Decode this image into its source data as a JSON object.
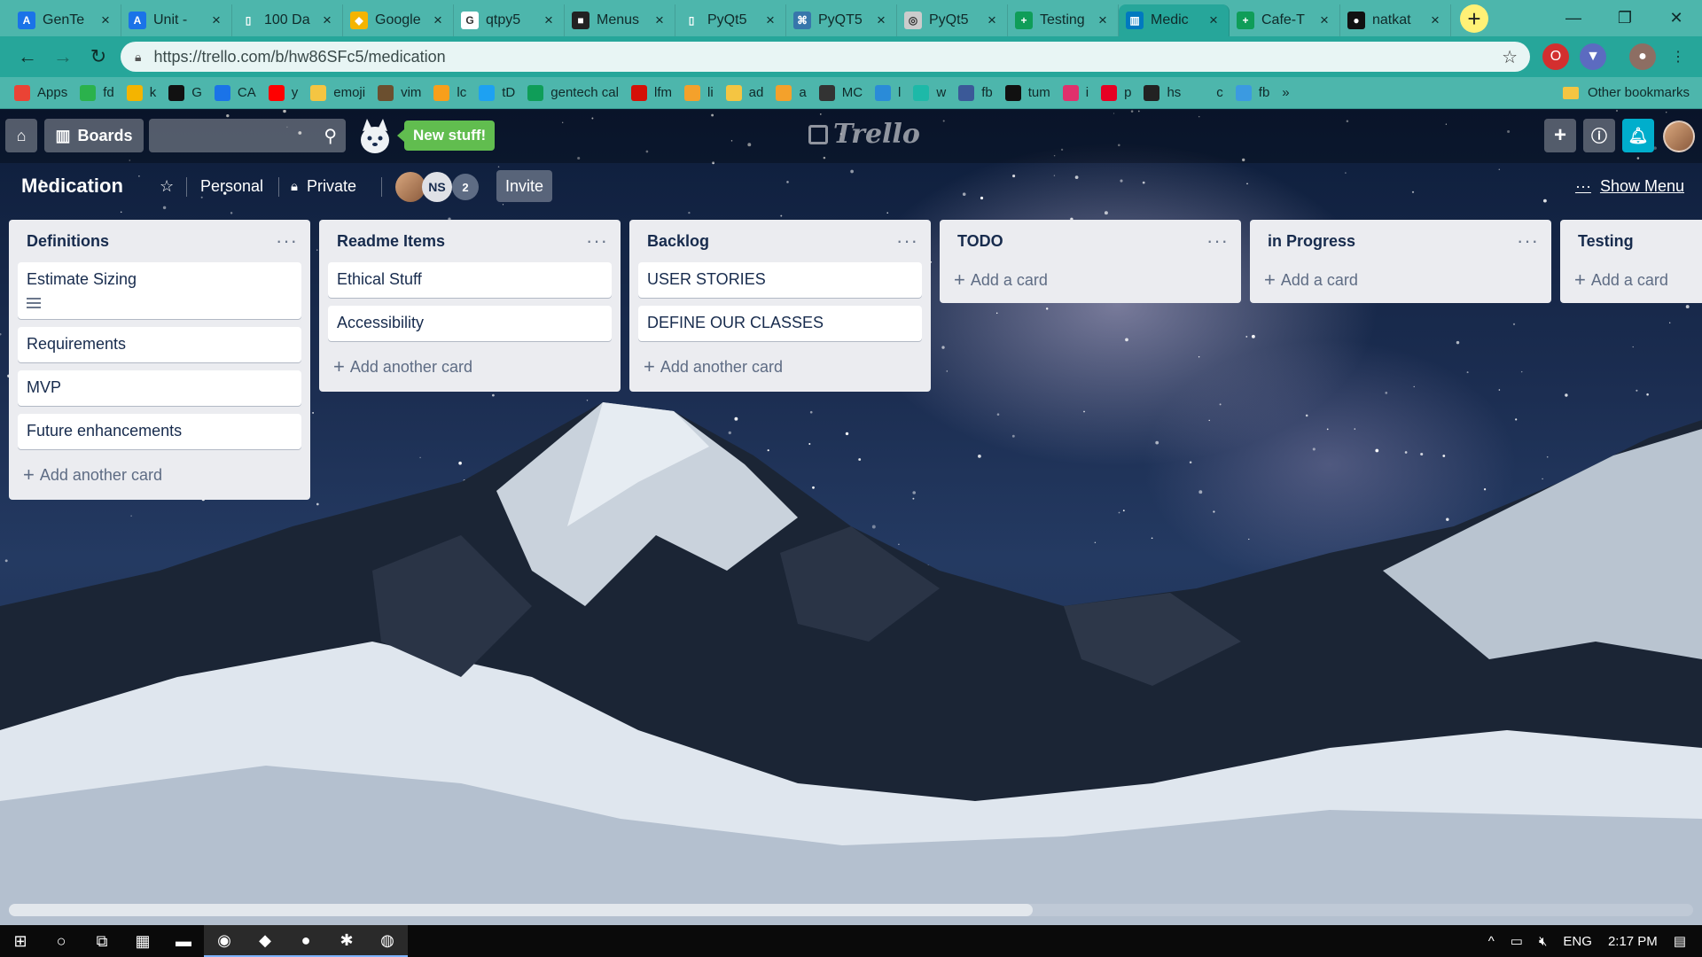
{
  "browser": {
    "tabs": [
      {
        "label": "GenTe",
        "icon": "gentech-icon",
        "color": "#1a73e8",
        "glyph": "A"
      },
      {
        "label": "Unit -",
        "icon": "atlassian-icon",
        "color": "#1a73e8",
        "glyph": "A"
      },
      {
        "label": "100 Da",
        "icon": "document-icon",
        "color": "#4db6ac",
        "glyph": "▯"
      },
      {
        "label": "Google",
        "icon": "keep-icon",
        "color": "#f4b400",
        "glyph": "◆"
      },
      {
        "label": "qtpy5",
        "icon": "google-icon",
        "color": "#ffffff",
        "glyph": "G"
      },
      {
        "label": "Menus",
        "icon": "page-icon",
        "color": "#222222",
        "glyph": "■"
      },
      {
        "label": "PyQt5",
        "icon": "document-icon",
        "color": "#4db6ac",
        "glyph": "▯"
      },
      {
        "label": "PyQT5",
        "icon": "python-icon",
        "color": "#3776ab",
        "glyph": "⌘"
      },
      {
        "label": "PyQt5",
        "icon": "pyqt-icon",
        "color": "#cccccc",
        "glyph": "◎"
      },
      {
        "label": "Testing",
        "icon": "sheets-icon",
        "color": "#0f9d58",
        "glyph": "+"
      },
      {
        "label": "Medic",
        "icon": "trello-icon",
        "color": "#0079bf",
        "glyph": "▥",
        "active": true
      },
      {
        "label": "Cafe-T",
        "icon": "sheets-icon",
        "color": "#0f9d58",
        "glyph": "+"
      },
      {
        "label": "natkat",
        "icon": "github-icon",
        "color": "#111111",
        "glyph": "●"
      }
    ],
    "url": "https://trello.com/b/hw86SFc5/medication",
    "bookmarks": [
      {
        "label": "Apps",
        "icon": "apps-icon",
        "color": "#ea4335"
      },
      {
        "label": "fd",
        "icon": "feedly-icon",
        "color": "#2bb24c"
      },
      {
        "label": "k",
        "icon": "keep-icon",
        "color": "#f4b400"
      },
      {
        "label": "G",
        "icon": "github-icon",
        "color": "#111111"
      },
      {
        "label": "CA",
        "icon": "atlassian-icon",
        "color": "#1a73e8"
      },
      {
        "label": "y",
        "icon": "youtube-icon",
        "color": "#ff0000"
      },
      {
        "label": "emoji",
        "icon": "emoji-icon",
        "color": "#f4c542"
      },
      {
        "label": "vim",
        "icon": "vim-icon",
        "color": "#6b4f2f"
      },
      {
        "label": "lc",
        "icon": "leetcode-icon",
        "color": "#f89f1b"
      },
      {
        "label": "tD",
        "icon": "twitter-icon",
        "color": "#1da1f2"
      },
      {
        "label": "gentech cal",
        "icon": "sheets-icon",
        "color": "#0f9d58"
      },
      {
        "label": "lfm",
        "icon": "lastfm-icon",
        "color": "#d51007"
      },
      {
        "label": "li",
        "icon": "bag-icon",
        "color": "#f4a12b"
      },
      {
        "label": "ad",
        "icon": "pencil-icon",
        "color": "#f4c542"
      },
      {
        "label": "a",
        "icon": "chart-icon",
        "color": "#f4a12b"
      },
      {
        "label": "MC",
        "icon": "mailchimp-icon",
        "color": "#333333"
      },
      {
        "label": "l",
        "icon": "link-icon",
        "color": "#2a8bd8"
      },
      {
        "label": "w",
        "icon": "web-icon",
        "color": "#1db9a8"
      },
      {
        "label": "fb",
        "icon": "facebook-icon",
        "color": "#3b5998"
      },
      {
        "label": "tum",
        "icon": "tumblr-icon",
        "color": "#111111"
      },
      {
        "label": "i",
        "icon": "instagram-icon",
        "color": "#e1306c"
      },
      {
        "label": "p",
        "icon": "pinterest-icon",
        "color": "#e60023"
      },
      {
        "label": "hs",
        "icon": "hackster-icon",
        "color": "#222222"
      },
      {
        "label": "c",
        "icon": "code-icon",
        "color": "#4db6ac"
      },
      {
        "label": "fb",
        "icon": "slack-icon",
        "color": "#3b9ae1"
      }
    ],
    "more_bookmarks": "»",
    "other_bookmarks": "Other bookmarks"
  },
  "trello": {
    "boards_label": "Boards",
    "new_stuff": "New stuff!",
    "logo": "Trello",
    "board_title": "Medication",
    "visibility_team": "Personal",
    "visibility": "Private",
    "member_initials": "NS",
    "member_count": "2",
    "invite": "Invite",
    "show_menu": "Show Menu",
    "more_glyph": "···",
    "lists": [
      {
        "title": "Definitions",
        "cards": [
          {
            "text": "Estimate Sizing",
            "has_description": true
          },
          {
            "text": "Requirements"
          },
          {
            "text": "MVP"
          },
          {
            "text": "Future enhancements"
          }
        ],
        "add_label": "Add another card"
      },
      {
        "title": "Readme Items",
        "cards": [
          {
            "text": "Ethical Stuff"
          },
          {
            "text": "Accessibility"
          }
        ],
        "add_label": "Add another card"
      },
      {
        "title": "Backlog",
        "cards": [
          {
            "text": "USER STORIES"
          },
          {
            "text": "DEFINE OUR CLASSES"
          }
        ],
        "add_label": "Add another card"
      },
      {
        "title": "TODO",
        "cards": [],
        "add_label": "Add a card"
      },
      {
        "title": "in Progress",
        "cards": [],
        "add_label": "Add a card"
      },
      {
        "title": "Testing",
        "cards": [],
        "add_label": "Add a card"
      }
    ]
  },
  "taskbar": {
    "apps": [
      "windows-start-icon",
      "cortana-icon",
      "task-view-icon",
      "calculator-icon",
      "file-explorer-icon",
      "chrome-icon",
      "vscode-icon",
      "obs-icon",
      "slack-icon",
      "discord-icon"
    ],
    "language": "ENG",
    "time": "2:17 PM"
  }
}
